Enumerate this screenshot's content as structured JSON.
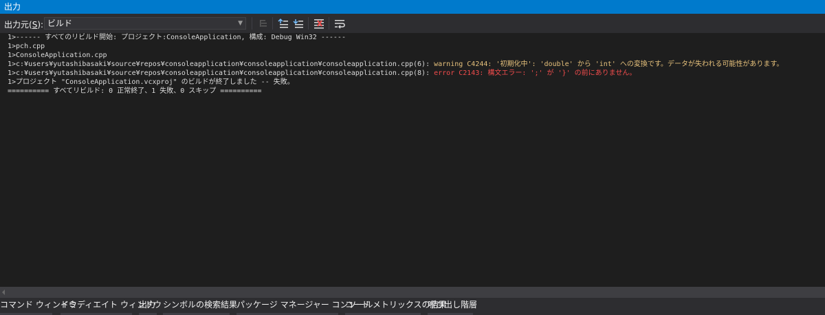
{
  "panel": {
    "title": "出力"
  },
  "toolbar": {
    "source_label": "出力元(",
    "source_label_accel": "S",
    "source_label_end": "):",
    "source_value": "ビルド",
    "buttons": [
      {
        "name": "find-message-in-code-icon",
        "enabled": false
      },
      {
        "name": "previous-message-icon",
        "enabled": true
      },
      {
        "name": "next-message-icon",
        "enabled": true
      },
      {
        "name": "clear-all-icon",
        "enabled": true
      },
      {
        "name": "word-wrap-icon",
        "enabled": true
      }
    ]
  },
  "output_lines": [
    {
      "text": "1>------ すべてのリビルド開始: プロジェクト:ConsoleApplication, 構成: Debug Win32 ------"
    },
    {
      "text": "1>pch.cpp"
    },
    {
      "text": "1>ConsoleApplication.cpp"
    },
    {
      "text": "1>c:¥users¥yutashibasaki¥source¥repos¥consoleapplication¥consoleapplication¥consoleapplication.cpp(6): ",
      "highlight": "warning C4244: '初期化中': 'double' から 'int' への変換です。データが失われる可能性があります。",
      "kind": "warning"
    },
    {
      "text": "1>c:¥users¥yutashibasaki¥source¥repos¥consoleapplication¥consoleapplication¥consoleapplication.cpp(8): ",
      "highlight": "error C2143: 構文エラー: ';' が '}' の前にありません。",
      "kind": "error"
    },
    {
      "text": "1>プロジェクト \"ConsoleApplication.vcxproj\" のビルドが終了しました -- 失敗。"
    },
    {
      "text": "========== すべてリビルド: 0 正常終了、1 失敗、0 スキップ =========="
    }
  ],
  "bottom_tabs": [
    "コマンド ウィンドウ",
    "イミディエイト ウィンドウ",
    "出力",
    "シンボルの検索結果",
    "パッケージ マネージャー コンソール",
    "コード メトリックスの結果",
    "呼び出し階層"
  ],
  "colors": {
    "accent": "#007acc",
    "background": "#1e1e1e",
    "toolbar": "#2d2d30",
    "text": "#dcdcdc",
    "warning": "#e5c07b",
    "error": "#f14c4c"
  }
}
